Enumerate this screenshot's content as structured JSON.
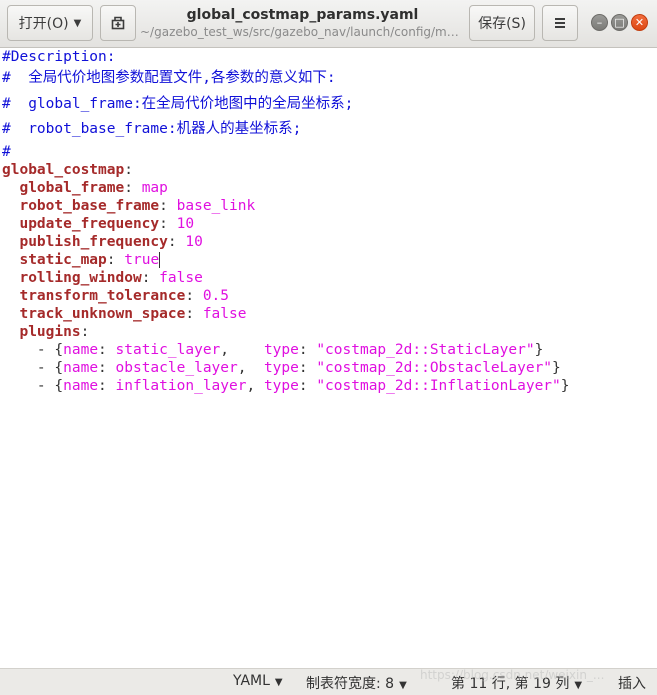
{
  "header": {
    "open_label": "打开(O)",
    "title": "global_costmap_params.yaml",
    "subtitle": "~/gazebo_test_ws/src/gazebo_nav/launch/config/mov...",
    "save_label": "保存(S)",
    "menu_icon": "hamburger-icon",
    "pin_icon": "new-tab-icon"
  },
  "editor": {
    "comments": [
      "#Description:",
      "#  全局代价地图参数配置文件,各参数的意义如下:",
      "#  global_frame:在全局代价地图中的全局坐标系;",
      "#  robot_base_frame:机器人的基坐标系;",
      "#"
    ],
    "root_key": "global_costmap",
    "params": [
      {
        "key": "global_frame",
        "value": "map"
      },
      {
        "key": "robot_base_frame",
        "value": "base_link"
      },
      {
        "key": "update_frequency",
        "value": "10"
      },
      {
        "key": "publish_frequency",
        "value": "10"
      },
      {
        "key": "static_map",
        "value": "true"
      },
      {
        "key": "rolling_window",
        "value": "false"
      },
      {
        "key": "transform_tolerance",
        "value": "0.5"
      },
      {
        "key": "track_unknown_space",
        "value": "false"
      }
    ],
    "plugins_key": "plugins",
    "plugins": [
      {
        "name_key": "name",
        "name": "static_layer",
        "type_key": "type",
        "type": "\"costmap_2d::StaticLayer\""
      },
      {
        "name_key": "name",
        "name": "obstacle_layer",
        "type_key": "type",
        "type": "\"costmap_2d::ObstacleLayer\""
      },
      {
        "name_key": "name",
        "name": "inflation_layer",
        "type_key": "type",
        "type": "\"costmap_2d::InflationLayer\""
      }
    ]
  },
  "status": {
    "language": "YAML",
    "tab_width": "制表符宽度: 8",
    "position": "第 11 行, 第 19 列",
    "insert_mode": "插入"
  },
  "watermark": "https://blog.csdn.net/weixin_..."
}
